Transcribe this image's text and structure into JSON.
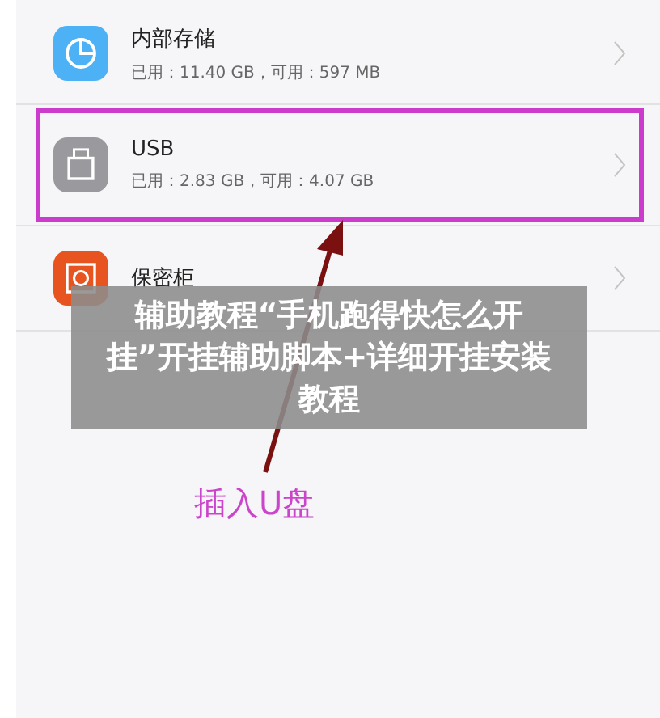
{
  "storage_list": [
    {
      "kind": "pie",
      "title": "内部存储",
      "detail": "已用：11.40 GB，可用：597 MB",
      "highlighted": false
    },
    {
      "kind": "usb",
      "title": "USB",
      "detail": "已用：2.83 GB，可用：4.07 GB",
      "highlighted": true
    },
    {
      "kind": "safe",
      "title": "保密柜",
      "highlighted": false
    }
  ],
  "annotation": {
    "text": "插入U盘"
  },
  "banner": {
    "text": "辅助教程“手机跑得快怎么开挂”开挂辅助脚本+详细开挂安装教程"
  }
}
